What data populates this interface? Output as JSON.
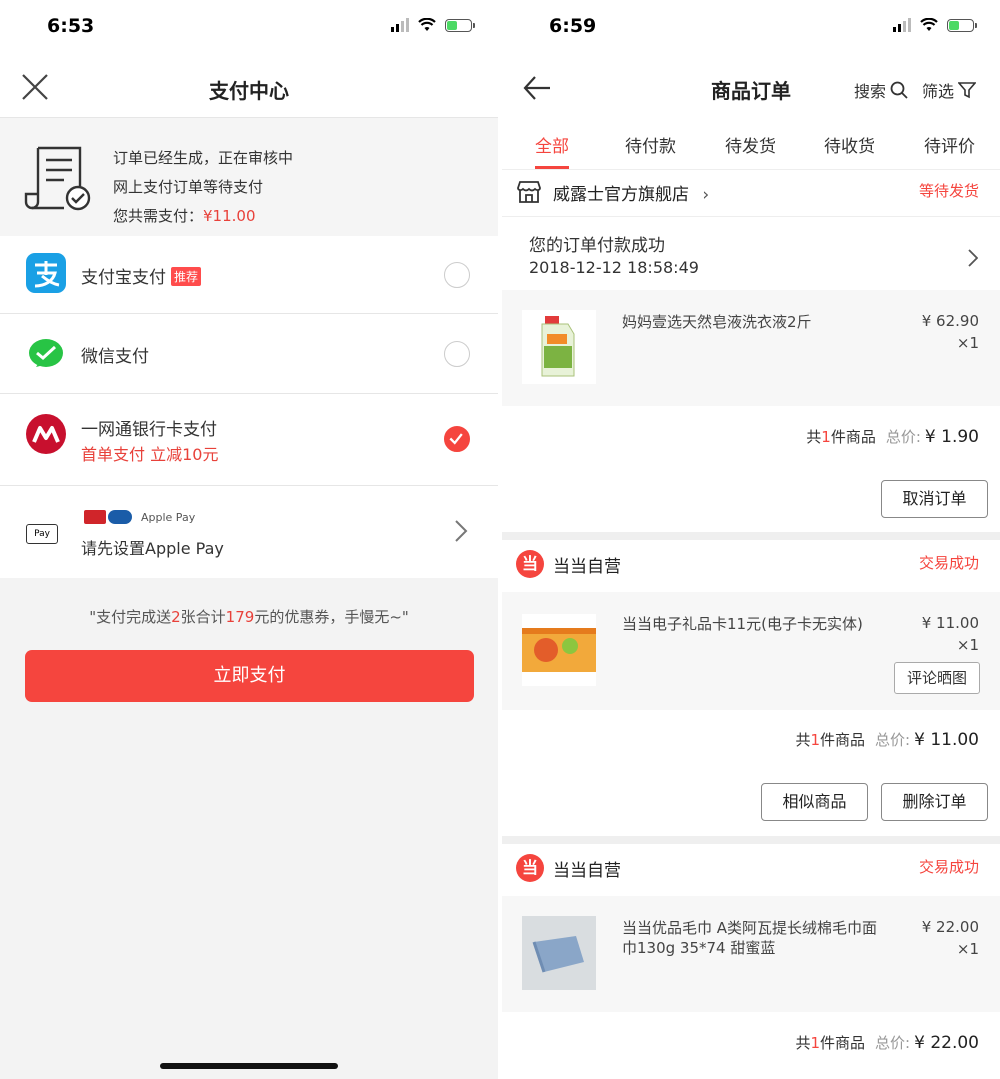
{
  "left": {
    "status_time": "6:53",
    "title": "支付中心",
    "order": {
      "line1": "订单已经生成，正在审核中",
      "line2": "网上支付订单等待支付",
      "amount_label": "您共需支付：",
      "amount": "¥11.00"
    },
    "methods": [
      {
        "label": "支付宝支付",
        "badge": "推荐",
        "selected": false,
        "icon": "alipay-icon"
      },
      {
        "label": "微信支付",
        "selected": false,
        "icon": "wechat-pay-icon"
      },
      {
        "label": "一网通银行卡支付",
        "sub": "首单支付 立减10元",
        "selected": true,
        "icon": "cmb-icon"
      },
      {
        "label": "请先设置Apple Pay",
        "top_text": "Apple Pay",
        "selected": false,
        "icon": "apple-pay-icon"
      }
    ],
    "promo": {
      "p1": "\"支付完成送",
      "n1": "2",
      "p2": "张合计",
      "n2": "179",
      "p3": "元的优惠券，手慢无~\""
    },
    "pay_button": "立即支付"
  },
  "right": {
    "status_time": "6:59",
    "title": "商品订单",
    "search": "搜索",
    "filter": "筛选",
    "tabs": [
      "全部",
      "待付款",
      "待发货",
      "待收货",
      "待评价"
    ],
    "orders": [
      {
        "shop": "威露士官方旗舰店",
        "status": "等待发货",
        "pay_msg": "您的订单付款成功",
        "pay_time": "2018-12-12 18:58:49",
        "item_name": "妈妈壹选天然皂液洗衣液2斤",
        "price": "¥ 62.90",
        "qty": "×1",
        "count_pre": "共",
        "count": "1",
        "count_post": "件商品",
        "total_label": "总价:",
        "total": "¥ 1.90",
        "buttons": [
          "取消订单"
        ]
      },
      {
        "shop": "当当自营",
        "status": "交易成功",
        "item_name": "当当电子礼品卡11元(电子卡无实体)",
        "price": "¥ 11.00",
        "qty": "×1",
        "item_button": "评论晒图",
        "count_pre": "共",
        "count": "1",
        "count_post": "件商品",
        "total_label": "总价:",
        "total": "¥ 11.00",
        "buttons": [
          "相似商品",
          "删除订单"
        ]
      },
      {
        "shop": "当当自营",
        "status": "交易成功",
        "item_name": "当当优品毛巾 A类阿瓦提长绒棉毛巾面巾130g 35*74 甜蜜蓝",
        "price": "¥ 22.00",
        "qty": "×1",
        "count_pre": "共",
        "count": "1",
        "count_post": "件商品",
        "total_label": "总价:",
        "total": "¥ 22.00"
      }
    ]
  },
  "colors": {
    "accent": "#f5453e",
    "alipay": "#1aa0e5",
    "wechat": "#28c445",
    "cmb": "#c8102e"
  }
}
